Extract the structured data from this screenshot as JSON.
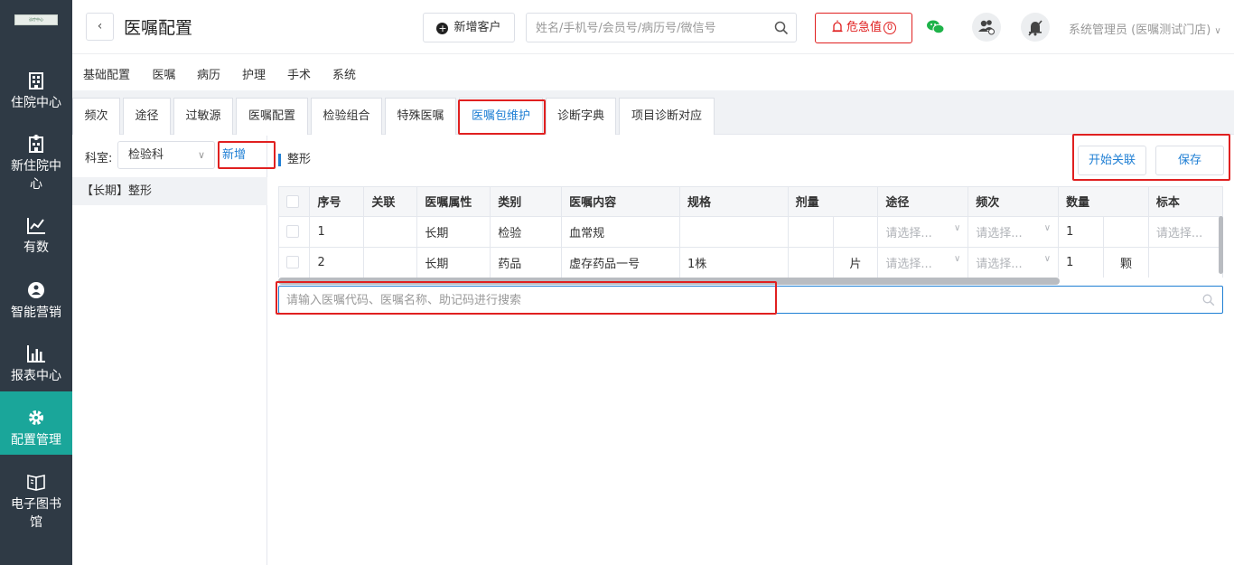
{
  "sidebar": {
    "logo_text": "诊疗中心",
    "items": [
      {
        "label": "住院中心",
        "icon": "building-icon"
      },
      {
        "label": "新住院中心",
        "icon": "hospital-icon"
      },
      {
        "label": "有数",
        "icon": "line-chart-icon"
      },
      {
        "label": "智能营销",
        "icon": "marketing-icon"
      },
      {
        "label": "报表中心",
        "icon": "bar-chart-icon"
      },
      {
        "label": "配置管理",
        "icon": "gear-icon"
      },
      {
        "label": "电子图书馆",
        "icon": "book-icon"
      }
    ],
    "active_color": "#1aa69a",
    "bg_color": "#2f3a45"
  },
  "header": {
    "back_icon": "‹",
    "title": "医嘱配置",
    "new_customer_label": "新增客户",
    "search_placeholder": "姓名/手机号/会员号/病历号/微信号",
    "danger_label": "危急值",
    "danger_count": "0",
    "user": "系统管理员 (医嘱测试门店)"
  },
  "tabs1": [
    "基础配置",
    "医嘱",
    "病历",
    "护理",
    "手术",
    "系统"
  ],
  "tabs2": [
    "频次",
    "途径",
    "过敏源",
    "医嘱配置",
    "检验组合",
    "特殊医嘱",
    "医嘱包维护",
    "诊断字典",
    "项目诊断对应"
  ],
  "left": {
    "dept_label": "科室:",
    "dept_value": "检验科",
    "add_label": "新增",
    "packages": [
      "【长期】整形"
    ]
  },
  "main": {
    "package_title": "整形",
    "start_link_label": "开始关联",
    "save_label": "保存",
    "columns": [
      "序号",
      "关联",
      "医嘱属性",
      "类别",
      "医嘱内容",
      "规格",
      "剂量",
      "途径",
      "频次",
      "数量",
      "标本"
    ],
    "select_placeholder": "请选择...",
    "rows": [
      {
        "no": "1",
        "link": "",
        "attr": "长期",
        "category": "检验",
        "content": "血常规",
        "spec": "",
        "dose": "",
        "dose_unit": "",
        "qty": "1",
        "qty_unit": ""
      },
      {
        "no": "2",
        "link": "",
        "attr": "长期",
        "category": "药品",
        "content": "虚存药品一号",
        "spec": "1株",
        "dose": "",
        "dose_unit": "片",
        "qty": "1",
        "qty_unit": "颗"
      }
    ],
    "order_search_placeholder": "请输入医嘱代码、医嘱名称、助记码进行搜索"
  },
  "colors": {
    "accent": "#1f7fd4",
    "danger": "#e02020"
  }
}
